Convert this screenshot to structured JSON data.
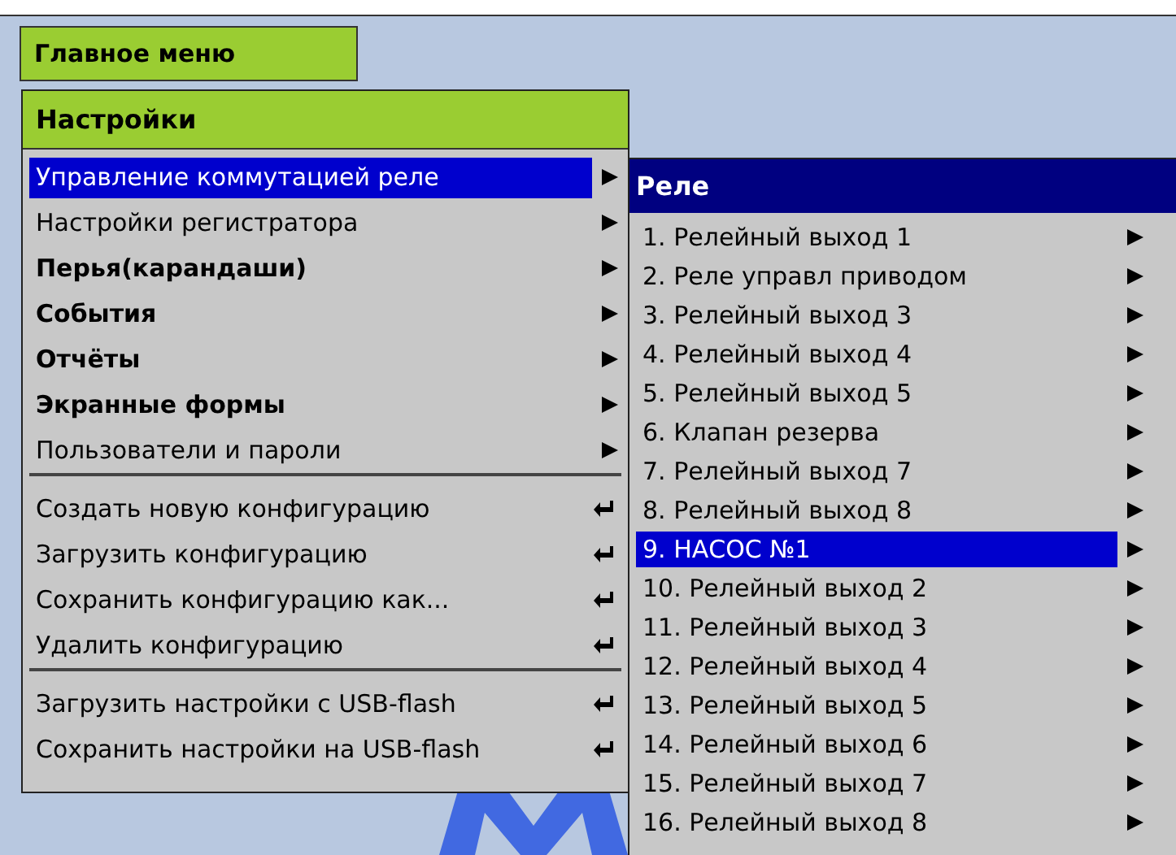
{
  "main_menu": {
    "title": "Главное меню"
  },
  "settings_menu": {
    "title": "Настройки",
    "groups": [
      [
        {
          "label": "Управление коммутацией реле",
          "kind": "submenu",
          "bold": false,
          "selected": true
        },
        {
          "label": "Настройки регистратора",
          "kind": "submenu",
          "bold": false,
          "selected": false
        },
        {
          "label": "Перья(карандаши)",
          "kind": "submenu",
          "bold": true,
          "selected": false
        },
        {
          "label": "События",
          "kind": "submenu",
          "bold": true,
          "selected": false
        },
        {
          "label": "Отчёты",
          "kind": "submenu",
          "bold": true,
          "selected": false
        },
        {
          "label": "Экранные формы",
          "kind": "submenu",
          "bold": true,
          "selected": false
        },
        {
          "label": "Пользователи и пароли",
          "kind": "submenu",
          "bold": false,
          "selected": false
        }
      ],
      [
        {
          "label": "Создать новую конфигурацию",
          "kind": "action",
          "bold": false,
          "selected": false
        },
        {
          "label": "Загрузить конфигурацию",
          "kind": "action",
          "bold": false,
          "selected": false
        },
        {
          "label": "Сохранить конфигурацию как...",
          "kind": "action",
          "bold": false,
          "selected": false
        },
        {
          "label": "Удалить конфигурацию",
          "kind": "action",
          "bold": false,
          "selected": false
        }
      ],
      [
        {
          "label": "Загрузить настройки с USB-flash",
          "kind": "action",
          "bold": false,
          "selected": false
        },
        {
          "label": "Сохранить настройки на USB-flash",
          "kind": "action",
          "bold": false,
          "selected": false
        }
      ]
    ]
  },
  "relay_menu": {
    "title": "Реле",
    "items": [
      {
        "label": "1. Релейный выход 1",
        "selected": false
      },
      {
        "label": "2. Реле управл приводом",
        "selected": false
      },
      {
        "label": "3. Релейный выход 3",
        "selected": false
      },
      {
        "label": "4. Релейный выход 4",
        "selected": false
      },
      {
        "label": "5. Релейный выход 5",
        "selected": false
      },
      {
        "label": "6. Клапан резерва",
        "selected": false
      },
      {
        "label": "7. Релейный выход 7",
        "selected": false
      },
      {
        "label": "8. Релейный выход 8",
        "selected": false
      },
      {
        "label": "9. НАСОС №1",
        "selected": true
      },
      {
        "label": "10. Релейный выход 2",
        "selected": false
      },
      {
        "label": "11. Релейный выход 3",
        "selected": false
      },
      {
        "label": "12. Релейный выход 4",
        "selected": false
      },
      {
        "label": "13. Релейный выход 5",
        "selected": false
      },
      {
        "label": "14. Релейный выход 6",
        "selected": false
      },
      {
        "label": "15. Релейный выход 7",
        "selected": false
      },
      {
        "label": "16. Релейный выход 8",
        "selected": false
      }
    ]
  }
}
